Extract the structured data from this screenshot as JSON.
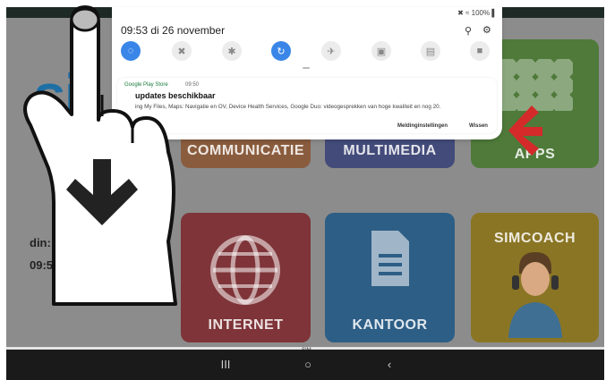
{
  "statusbar": {
    "right": "✖ ≈ 100% ▌"
  },
  "notification_shade": {
    "datetime": "09:53  di 26 november",
    "quick_settings": [
      {
        "name": "wifi",
        "icon": "wifi-icon",
        "glyph": "◌",
        "on": true
      },
      {
        "name": "sound",
        "icon": "mute-icon",
        "glyph": "✖",
        "on": false
      },
      {
        "name": "bluetooth",
        "icon": "bluetooth-icon",
        "glyph": "✱",
        "on": false
      },
      {
        "name": "auto-rotate",
        "icon": "rotate-icon",
        "glyph": "↻",
        "on": true
      },
      {
        "name": "airplane",
        "icon": "airplane-icon",
        "glyph": "✈",
        "on": false
      },
      {
        "name": "power-saving",
        "icon": "battery-icon",
        "glyph": "▣",
        "on": false
      },
      {
        "name": "reading",
        "icon": "book-icon",
        "glyph": "▤",
        "on": false
      },
      {
        "name": "secure-folder",
        "icon": "folder-icon",
        "glyph": "■",
        "on": false
      }
    ],
    "notification": {
      "app": "Google Play Store",
      "time": "09:50",
      "title": "updates beschikbaar",
      "body": "ing My Files, Maps: Navigatie en OV, Device Health Services, Google Duo: videogesprekken van hoge kwaliteit en nog 20.",
      "settings_label": "Meldinginstellingen",
      "clear_label": "Wissen"
    }
  },
  "home": {
    "logo": "si",
    "date_partial": "din:",
    "time_partial": "09:5",
    "bottom_label": "SIM",
    "tiles": [
      {
        "id": "communicatie",
        "label": "COMMUNICATIE",
        "color": "#d4692c"
      },
      {
        "id": "multimedia",
        "label": "MULTIMEDIA",
        "color": "#3a4fb3"
      },
      {
        "id": "apps",
        "label": "APPS",
        "color": "#5cab36"
      },
      {
        "id": "internet",
        "label": "INTERNET",
        "color": "#c9323c"
      },
      {
        "id": "kantoor",
        "label": "KANTOOR",
        "color": "#1c7fca"
      },
      {
        "id": "simcoach",
        "label": "SIMCOACH",
        "color": "#e9c20c"
      }
    ]
  },
  "navbar": {
    "recents": "III",
    "home": "○",
    "back": "‹"
  }
}
